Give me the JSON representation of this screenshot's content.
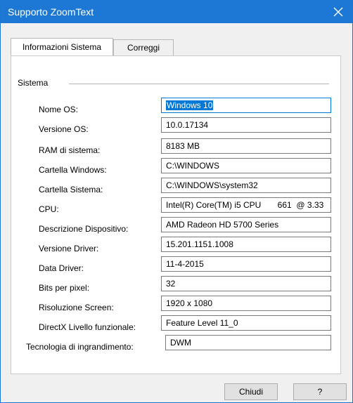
{
  "window": {
    "title": "Supporto ZoomText",
    "title_color": "#1c78d4"
  },
  "tabs": [
    {
      "label": "Informazioni Sistema",
      "active": true
    },
    {
      "label": "Correggi",
      "active": false
    }
  ],
  "group": {
    "label": "Sistema"
  },
  "fields": [
    {
      "label": "Nome OS:",
      "value": "Windows 10"
    },
    {
      "label": "Versione OS:",
      "value": "10.0.17134"
    },
    {
      "label": "RAM di sistema:",
      "value": "8183 MB"
    },
    {
      "label": "Cartella Windows:",
      "value": "C:\\WINDOWS"
    },
    {
      "label": "Cartella Sistema:",
      "value": "C:\\WINDOWS\\system32"
    },
    {
      "label": "CPU:",
      "value": "Intel(R) Core(TM) i5 CPU       661  @ 3.33"
    },
    {
      "label": "Descrizione Dispositivo:",
      "value": "AMD Radeon HD 5700 Series"
    },
    {
      "label": "Versione Driver:",
      "value": "15.201.1151.1008"
    },
    {
      "label": "Data Driver:",
      "value": "11-4-2015"
    },
    {
      "label": "Bits per pixel:",
      "value": "32"
    },
    {
      "label": "Risoluzione Screen:",
      "value": "1920 x 1080"
    },
    {
      "label": "DirectX Livello funzionale:",
      "value": "Feature Level 11_0"
    },
    {
      "label": "Tecnologia di ingrandimento:",
      "value": "DWM"
    }
  ],
  "buttons": {
    "close_label": "Chiudi",
    "help_label": "?"
  }
}
